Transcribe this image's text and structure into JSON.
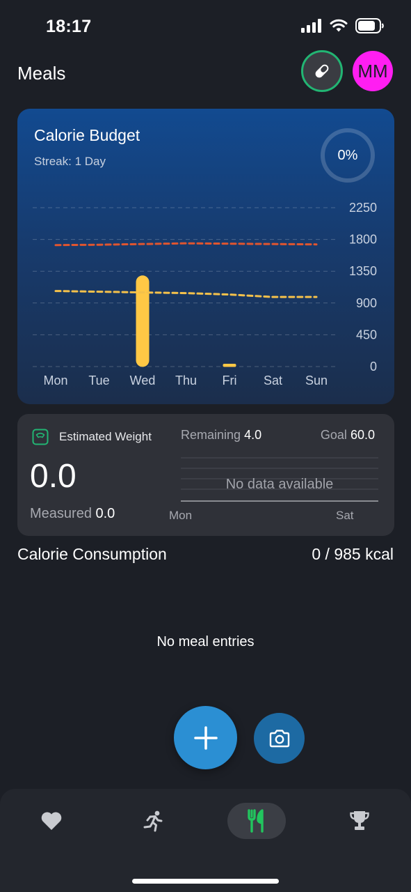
{
  "status_bar": {
    "time": "18:17"
  },
  "header": {
    "title": "Meals",
    "avatar_initials": "MM"
  },
  "budget_card": {
    "title": "Calorie Budget",
    "streak": "Streak: 1 Day",
    "progress_label": "0%"
  },
  "chart_data": {
    "type": "bar",
    "categories": [
      "Mon",
      "Tue",
      "Wed",
      "Thu",
      "Fri",
      "Sat",
      "Sun"
    ],
    "y_ticks": [
      "2250",
      "1800",
      "1350",
      "900",
      "450",
      "0"
    ],
    "ylim": [
      0,
      2250
    ],
    "series": [
      {
        "type": "bar",
        "values": [
          0,
          0,
          1290,
          0,
          40,
          0,
          0
        ],
        "color": "#ffc845"
      },
      {
        "type": "line",
        "style": "dashed",
        "values": [
          1720,
          1725,
          1735,
          1745,
          1740,
          1735,
          1730
        ],
        "color": "#e0552f"
      },
      {
        "type": "line",
        "style": "dashed",
        "values": [
          1070,
          1060,
          1050,
          1040,
          1020,
          985,
          985
        ],
        "color": "#f4c14b"
      }
    ],
    "grid": true,
    "xlabel": "",
    "ylabel": ""
  },
  "weight_card": {
    "title": "Estimated Weight",
    "value": "0.0",
    "measured_label": "Measured",
    "measured_value": "0.0",
    "remaining_label": "Remaining",
    "remaining_value": "4.0",
    "goal_label": "Goal",
    "goal_value": "60.0",
    "no_data": "No data available",
    "x_start": "Mon",
    "x_end": "Sat"
  },
  "consumption": {
    "label": "Calorie Consumption",
    "value": "0 / 985 kcal"
  },
  "empty_state": "No meal entries",
  "colors": {
    "accent_blue": "#2b8fd3",
    "ring_green": "#22b573",
    "avatar": "#ff1ef2",
    "nav_active": "#22c55e"
  },
  "nav": {
    "items": [
      {
        "icon": "heart-icon"
      },
      {
        "icon": "running-icon"
      },
      {
        "icon": "utensils-icon",
        "active": true
      },
      {
        "icon": "trophy-icon"
      }
    ]
  }
}
